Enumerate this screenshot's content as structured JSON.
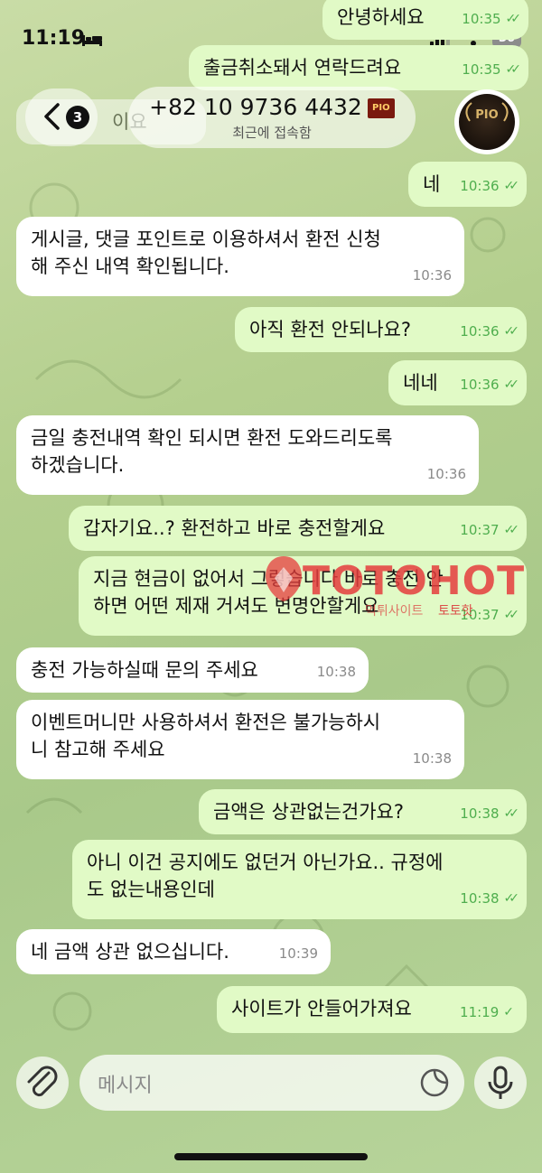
{
  "status_bar": {
    "time": "11:19",
    "battery": "36"
  },
  "header": {
    "back_count": "3",
    "phone": "+82 10 9736 4432",
    "phone_badge": "PIO",
    "substatus": "최근에 접속함",
    "avatar_text": "PIO"
  },
  "messages": [
    {
      "dir": "out",
      "text": "안녕하세요",
      "time": "10:35",
      "read": true
    },
    {
      "dir": "out",
      "text": "출금취소돼서 연락드려요",
      "time": "10:35",
      "read": true
    },
    {
      "dir": "in",
      "text": "이요",
      "time": ""
    },
    {
      "dir": "out",
      "text": "네",
      "time": "10:36",
      "read": true
    },
    {
      "dir": "in",
      "text": "게시글, 댓글 포인트로 이용하셔서 환전 신청\n해 주신 내역 확인됩니다.",
      "time": "10:36"
    },
    {
      "dir": "out",
      "text": "아직 환전 안되나요?",
      "time": "10:36",
      "read": true
    },
    {
      "dir": "out",
      "text": "네네",
      "time": "10:36",
      "read": true
    },
    {
      "dir": "in",
      "text": "금일 충전내역 확인 되시면 환전 도와드리도록\n하겠습니다.",
      "time": "10:36"
    },
    {
      "dir": "out",
      "text": "갑자기요..? 환전하고 바로 충전할게요",
      "time": "10:37",
      "read": true
    },
    {
      "dir": "out",
      "text": "지금 현금이 없어서 그렇습니다 바로 충전 안\n하면 어떤 제재 거셔도 변명안할게요",
      "time": "10:37",
      "read": true
    },
    {
      "dir": "in",
      "text": "충전 가능하실때 문의 주세요",
      "time": "10:38"
    },
    {
      "dir": "in",
      "text": "이벤트머니만 사용하셔서 환전은 불가능하시\n니 참고해 주세요",
      "time": "10:38"
    },
    {
      "dir": "out",
      "text": "금액은 상관없는건가요?",
      "time": "10:38",
      "read": true
    },
    {
      "dir": "out",
      "text": "아니 이건 공지에도 없던거 아닌가요.. 규정에\n도 없는내용인데",
      "time": "10:38",
      "read": true
    },
    {
      "dir": "in",
      "text": "네 금액 상관 없으십니다.",
      "time": "10:39"
    },
    {
      "dir": "out",
      "text": "사이트가 안들어가져요",
      "time": "11:19",
      "read": false
    }
  ],
  "composer": {
    "placeholder": "메시지"
  },
  "watermark": {
    "text": "TOTOHOT",
    "sub_a": "먹튀사이트",
    "sub_b": "토토핫"
  },
  "colors": {
    "outgoing": "#e1fac6",
    "incoming": "#ffffff",
    "check": "#4fae4e"
  }
}
